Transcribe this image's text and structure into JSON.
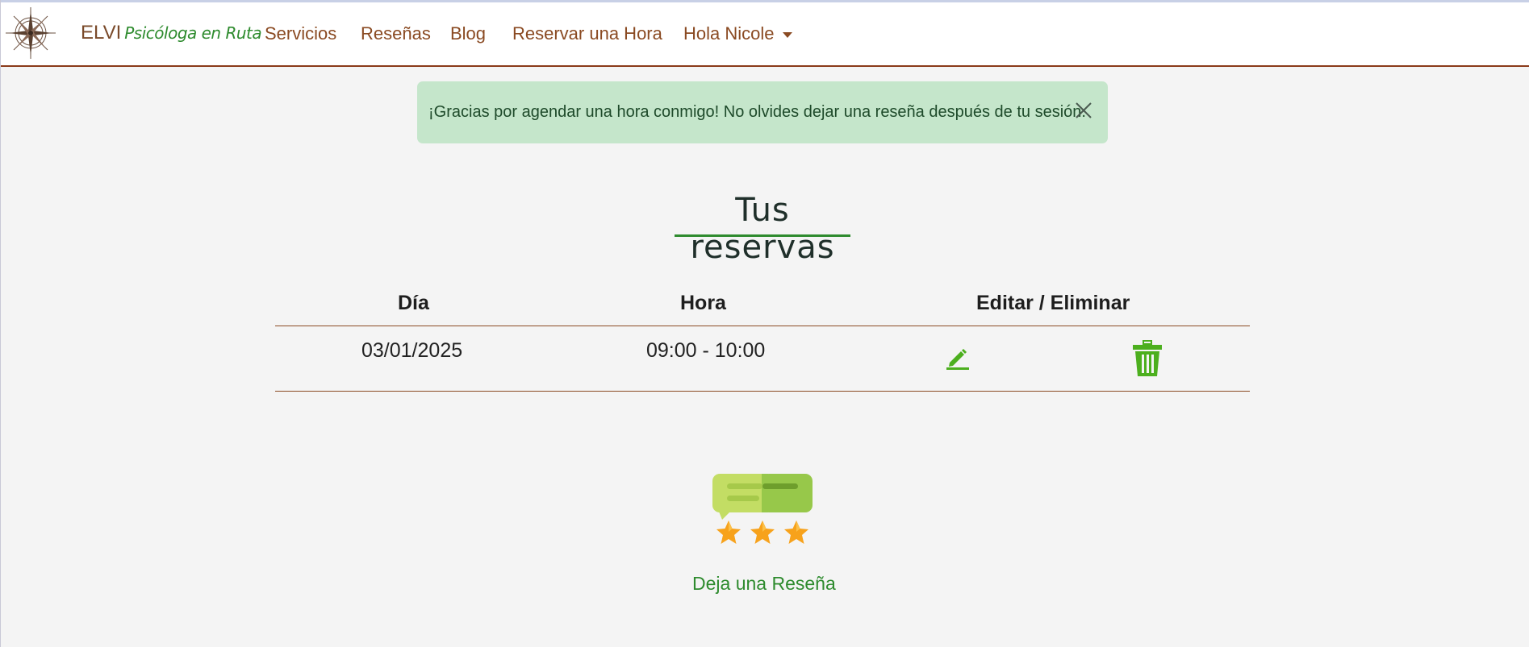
{
  "navbar": {
    "brand_main": "ELVI",
    "brand_sub": "Psicóloga en Ruta",
    "items": [
      {
        "label": "Servicios"
      },
      {
        "label": "Reseñas"
      },
      {
        "label": "Blog"
      },
      {
        "label": "Reservar una Hora"
      },
      {
        "label": "Hola Nicole"
      }
    ],
    "logo_icon": "compass-rose-icon"
  },
  "alert": {
    "message": "¡Gracias por agendar una hora conmigo! No olvides dejar una reseña después de tu sesión.",
    "close_icon": "close-icon"
  },
  "page_title": "Tus reservas",
  "table": {
    "headers": [
      "Día",
      "Hora",
      "Editar / Eliminar"
    ],
    "rows": [
      {
        "day": "03/01/2025",
        "time": "09:00 - 10:00",
        "edit_icon": "pencil-icon",
        "delete_icon": "trash-icon"
      }
    ]
  },
  "review": {
    "icon": "review-stars-icon",
    "link_label": "Deja una Reseña"
  },
  "colors": {
    "accent_green": "#2e8b2e",
    "brand_brown": "#8a4a22",
    "alert_bg": "#c5e6cb",
    "icon_green": "#4caf1e",
    "star_orange": "#f7a21b"
  }
}
